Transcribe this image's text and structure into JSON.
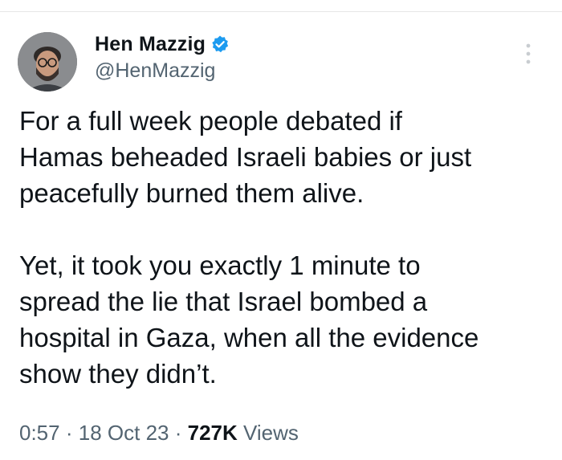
{
  "author": {
    "display_name": "Hen Mazzig",
    "handle": "@HenMazzig",
    "verified": true,
    "verified_color": "#1d9bf0"
  },
  "menu": {
    "icon": "more-vertical-icon"
  },
  "tweet": {
    "paragraph_1": "For a full week people debated if\nHamas beheaded Israeli babies or just\npeacefully burned them alive.",
    "paragraph_2": "Yet, it took you exactly 1 minute to\nspread the lie that Israel bombed a\nhospital in Gaza, when all the evidence\nshow they didn’t."
  },
  "meta": {
    "time": "0:57",
    "separator": "·",
    "date": "18 Oct 23",
    "views_count": "727K",
    "views_label": "Views"
  },
  "colors": {
    "text": "#0f1419",
    "secondary": "#536471"
  }
}
